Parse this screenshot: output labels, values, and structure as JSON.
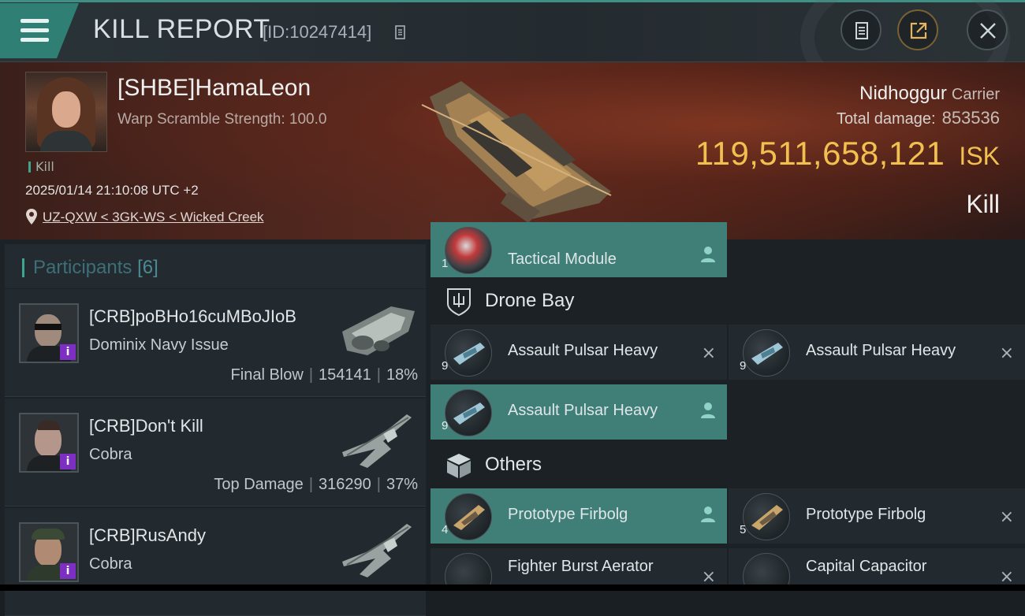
{
  "header": {
    "title": "KILL REPORT",
    "report_id": "[ID:10247414]"
  },
  "victim": {
    "name": "[SHBE]HamaLeon",
    "warp_scramble": "Warp Scramble Strength: 100.0",
    "kill_tag": "Kill",
    "datetime": "2025/01/14 21:10:08 UTC +2",
    "location": "UZ-QXW < 3GK-WS < Wicked Creek",
    "ship_name": "Nidhoggur",
    "ship_class": "Carrier",
    "total_damage_label": "Total damage:",
    "total_damage": "853536",
    "isk_value": "119,511,658,121",
    "isk_unit": "ISK",
    "result": "Kill"
  },
  "participants": {
    "title": "Participants",
    "count": "[6]",
    "items": [
      {
        "name": "[CRB]poBHo16cuMBoJIoB",
        "ship": "Dominix Navy Issue",
        "stat_label": "Final Blow",
        "damage": "154141",
        "percent": "18%",
        "info": "i"
      },
      {
        "name": "[CRB]Don't Kill",
        "ship": "Cobra",
        "stat_label": "Top Damage",
        "damage": "316290",
        "percent": "37%",
        "info": "i"
      },
      {
        "name": "[CRB]RusAndy",
        "ship": "Cobra",
        "stat_label": "",
        "damage": "",
        "percent": "",
        "info": "i"
      }
    ]
  },
  "fitting": {
    "top_slot": {
      "name": "Tactical Module",
      "qty": "1"
    },
    "drone_bay": {
      "title": "Drone Bay",
      "items": [
        {
          "name": "Assault Pulsar Heavy",
          "qty": "9"
        },
        {
          "name": "Assault Pulsar Heavy",
          "qty": "9"
        },
        {
          "name": "Assault Pulsar Heavy",
          "qty": "9"
        }
      ]
    },
    "others": {
      "title": "Others",
      "items": [
        {
          "name": "Prototype Firbolg",
          "qty": "4"
        },
        {
          "name": "Prototype Firbolg",
          "qty": "5"
        },
        {
          "name": "Fighter Burst Aerator",
          "qty": ""
        },
        {
          "name": "Capital Capacitor",
          "qty": ""
        }
      ]
    },
    "destroyed_mark": "×"
  },
  "colors": {
    "accent_teal": "#3f7f78",
    "isk_gold": "#f2c04f",
    "info_purple": "#7d2fc4"
  }
}
